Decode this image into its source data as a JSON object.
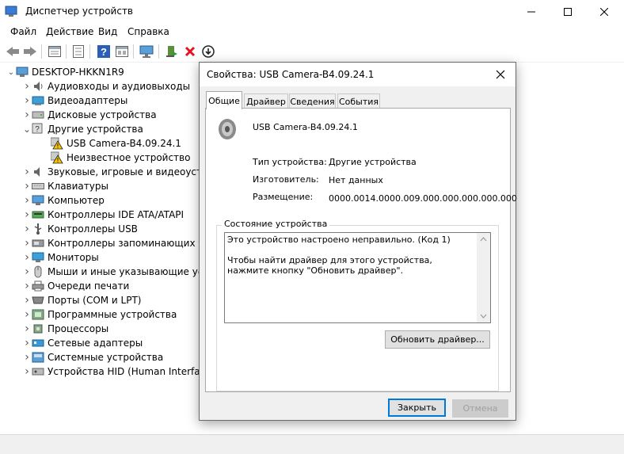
{
  "window": {
    "title": "Диспетчер устройств",
    "minimize_icon": "minimize-icon",
    "maximize_icon": "maximize-icon",
    "close_icon": "close-icon"
  },
  "menu": [
    "Файл",
    "Действие",
    "Вид",
    "Справка"
  ],
  "toolbar": {
    "icons": [
      "back-icon",
      "forward-icon",
      "properties-icon",
      "list-icon",
      "help-icon",
      "view-icon",
      "monitor-icon",
      "update-driver-icon",
      "uninstall-icon",
      "download-icon"
    ]
  },
  "tree": {
    "root": "DESKTOP-HKKN1R9",
    "items": [
      {
        "label": "Аудиовходы и аудиовыходы",
        "icon": "audio-icon",
        "expanded": false
      },
      {
        "label": "Видеоадаптеры",
        "icon": "display-adapter-icon",
        "expanded": false
      },
      {
        "label": "Дисковые устройства",
        "icon": "disk-icon",
        "expanded": false
      },
      {
        "label": "Другие устройства",
        "icon": "other-devices-icon",
        "expanded": true,
        "children": [
          "USB Camera-B4.09.24.1",
          "Неизвестное устройство"
        ]
      },
      {
        "label": "Звуковые, игровые и видеоустро",
        "icon": "sound-icon",
        "expanded": false
      },
      {
        "label": "Клавиатуры",
        "icon": "keyboard-icon",
        "expanded": false
      },
      {
        "label": "Компьютер",
        "icon": "computer-icon",
        "expanded": false
      },
      {
        "label": "Контроллеры IDE ATA/ATAPI",
        "icon": "ide-icon",
        "expanded": false
      },
      {
        "label": "Контроллеры USB",
        "icon": "usb-icon",
        "expanded": false
      },
      {
        "label": "Контроллеры запоминающих уст",
        "icon": "storage-icon",
        "expanded": false
      },
      {
        "label": "Мониторы",
        "icon": "monitor-icon",
        "expanded": false
      },
      {
        "label": "Мыши и иные указывающие устр",
        "icon": "mouse-icon",
        "expanded": false
      },
      {
        "label": "Очереди печати",
        "icon": "printer-icon",
        "expanded": false
      },
      {
        "label": "Порты (COM и LPT)",
        "icon": "port-icon",
        "expanded": false
      },
      {
        "label": "Программные устройства",
        "icon": "software-device-icon",
        "expanded": false
      },
      {
        "label": "Процессоры",
        "icon": "cpu-icon",
        "expanded": false
      },
      {
        "label": "Сетевые адаптеры",
        "icon": "network-icon",
        "expanded": false
      },
      {
        "label": "Системные устройства",
        "icon": "system-icon",
        "expanded": false
      },
      {
        "label": "Устройства HID (Human Interface",
        "icon": "hid-icon",
        "expanded": false
      }
    ]
  },
  "dialog": {
    "title": "Свойства: USB Camera-B4.09.24.1",
    "tabs": [
      "Общие",
      "Драйвер",
      "Сведения",
      "События"
    ],
    "active_tab": "Общие",
    "device_name": "USB Camera-B4.09.24.1",
    "props": [
      {
        "label": "Тип устройства:",
        "value": "Другие устройства"
      },
      {
        "label": "Изготовитель:",
        "value": "Нет данных"
      },
      {
        "label": "Размещение:",
        "value": "0000.0014.0000.009.000.000.000.000.000"
      }
    ],
    "status_group_title": "Состояние устройства",
    "status_text": "Это устройство настроено неправильно. (Код 1)\n\nЧтобы найти драйвер для этого устройства, нажмите кнопку \"Обновить драйвер\".",
    "update_driver_button": "Обновить драйвер...",
    "ok_button": "Закрыть",
    "cancel_button": "Отмена"
  },
  "colors": {
    "accent": "#0078d7",
    "warning": "#f5c400",
    "error_x": "#e81123"
  }
}
